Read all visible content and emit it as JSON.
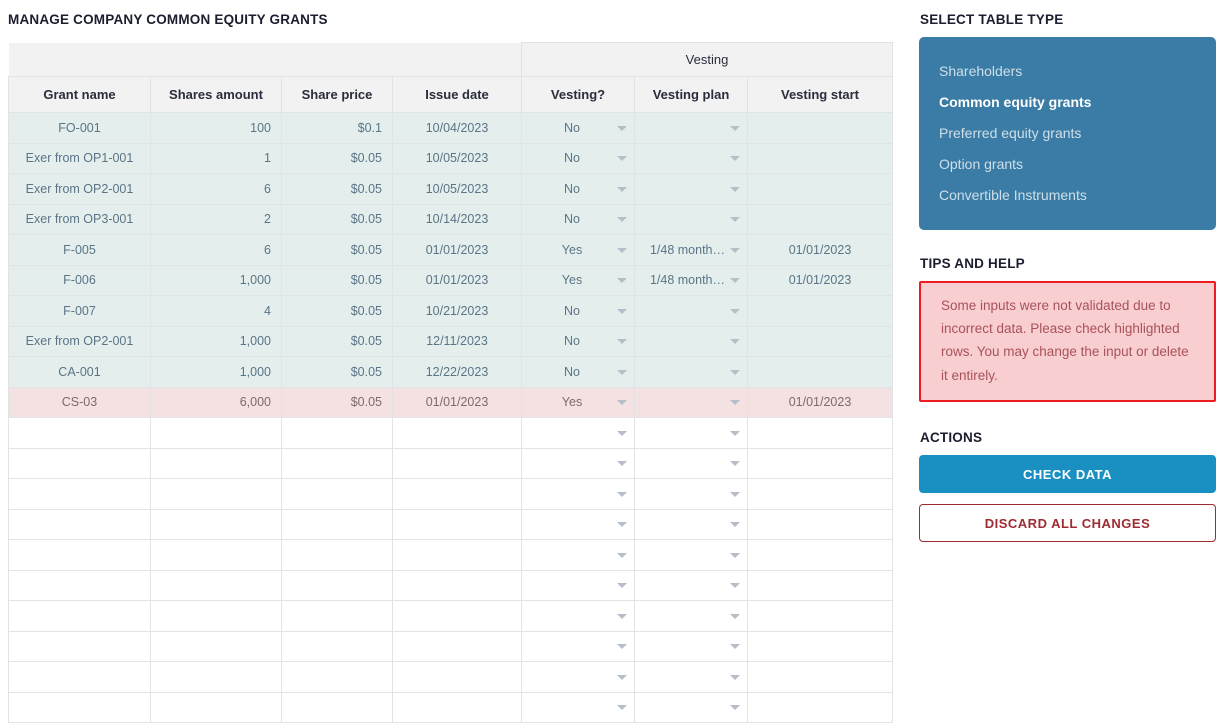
{
  "page_title": "Manage company common equity grants",
  "table": {
    "group_header": "Vesting",
    "columns": [
      "Grant name",
      "Shares amount",
      "Share price",
      "Issue date",
      "Vesting?",
      "Vesting plan",
      "Vesting start"
    ],
    "rows": [
      {
        "grant_name": "FO-001",
        "shares_amount": "100",
        "share_price": "$0.1",
        "issue_date": "10/04/2023",
        "vesting": "No",
        "vesting_plan": "",
        "vesting_start": "",
        "error": false
      },
      {
        "grant_name": "Exer from OP1-001",
        "shares_amount": "1",
        "share_price": "$0.05",
        "issue_date": "10/05/2023",
        "vesting": "No",
        "vesting_plan": "",
        "vesting_start": "",
        "error": false
      },
      {
        "grant_name": "Exer from OP2-001",
        "shares_amount": "6",
        "share_price": "$0.05",
        "issue_date": "10/05/2023",
        "vesting": "No",
        "vesting_plan": "",
        "vesting_start": "",
        "error": false
      },
      {
        "grant_name": "Exer from OP3-001",
        "shares_amount": "2",
        "share_price": "$0.05",
        "issue_date": "10/14/2023",
        "vesting": "No",
        "vesting_plan": "",
        "vesting_start": "",
        "error": false
      },
      {
        "grant_name": "F-005",
        "shares_amount": "6",
        "share_price": "$0.05",
        "issue_date": "01/01/2023",
        "vesting": "Yes",
        "vesting_plan": "1/48 month…",
        "vesting_start": "01/01/2023",
        "error": false
      },
      {
        "grant_name": "F-006",
        "shares_amount": "1,000",
        "share_price": "$0.05",
        "issue_date": "01/01/2023",
        "vesting": "Yes",
        "vesting_plan": "1/48 month…",
        "vesting_start": "01/01/2023",
        "error": false
      },
      {
        "grant_name": "F-007",
        "shares_amount": "4",
        "share_price": "$0.05",
        "issue_date": "10/21/2023",
        "vesting": "No",
        "vesting_plan": "",
        "vesting_start": "",
        "error": false
      },
      {
        "grant_name": "Exer from OP2-001",
        "shares_amount": "1,000",
        "share_price": "$0.05",
        "issue_date": "12/11/2023",
        "vesting": "No",
        "vesting_plan": "",
        "vesting_start": "",
        "error": false
      },
      {
        "grant_name": "CA-001",
        "shares_amount": "1,000",
        "share_price": "$0.05",
        "issue_date": "12/22/2023",
        "vesting": "No",
        "vesting_plan": "",
        "vesting_start": "",
        "error": false
      },
      {
        "grant_name": "CS-03",
        "shares_amount": "6,000",
        "share_price": "$0.05",
        "issue_date": "01/01/2023",
        "vesting": "Yes",
        "vesting_plan": "",
        "vesting_start": "01/01/2023",
        "error": true
      }
    ],
    "empty_row_count": 10,
    "dropdown_icon": "chevron-down-icon"
  },
  "sidebar": {
    "table_type": {
      "heading": "Select table type",
      "items": [
        {
          "label": "Shareholders",
          "active": false
        },
        {
          "label": "Common equity grants",
          "active": true
        },
        {
          "label": "Preferred equity grants",
          "active": false
        },
        {
          "label": "Option grants",
          "active": false
        },
        {
          "label": "Convertible Instruments",
          "active": false
        }
      ],
      "panel_color": "#3a7ca5"
    },
    "tips": {
      "heading": "Tips and help",
      "message": "Some inputs were not validated due to incorrect data. Please check highlighted rows. You may change the input or delete it entirely.",
      "border_color": "#ec1c24",
      "background_color": "#f9ced0",
      "text_color": "#a8525a"
    },
    "actions": {
      "heading": "Actions",
      "check_data_label": "Check data",
      "discard_label": "Discard all changes",
      "primary_color": "#1a90c2",
      "ghost_color": "#9e2b32"
    }
  }
}
